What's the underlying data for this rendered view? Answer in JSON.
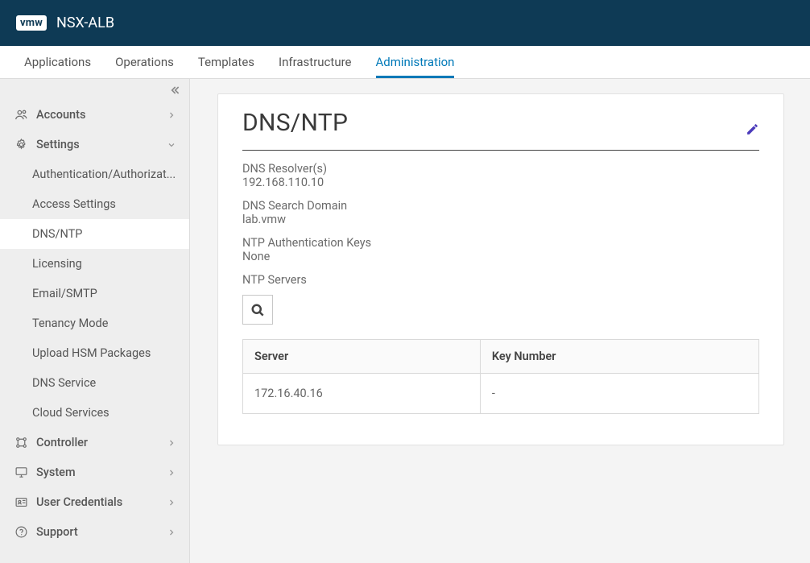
{
  "header": {
    "logo": "vmw",
    "product": "NSX-ALB"
  },
  "topnav": {
    "items": [
      "Applications",
      "Operations",
      "Templates",
      "Infrastructure",
      "Administration"
    ],
    "active_index": 4
  },
  "sidebar": {
    "groups": [
      {
        "label": "Accounts",
        "icon": "users",
        "expanded": false
      },
      {
        "label": "Settings",
        "icon": "gear",
        "expanded": true,
        "items": [
          "Authentication/Authorizat...",
          "Access Settings",
          "DNS/NTP",
          "Licensing",
          "Email/SMTP",
          "Tenancy Mode",
          "Upload HSM Packages",
          "DNS Service",
          "Cloud Services"
        ],
        "active_index": 2
      },
      {
        "label": "Controller",
        "icon": "nodes",
        "expanded": false
      },
      {
        "label": "System",
        "icon": "monitor",
        "expanded": false
      },
      {
        "label": "User Credentials",
        "icon": "idcard",
        "expanded": false
      },
      {
        "label": "Support",
        "icon": "help",
        "expanded": false
      }
    ]
  },
  "content": {
    "title": "DNS/NTP",
    "dns_resolvers_label": "DNS Resolver(s)",
    "dns_resolvers_value": "192.168.110.10",
    "dns_search_label": "DNS Search Domain",
    "dns_search_value": "lab.vmw",
    "ntp_auth_label": "NTP Authentication Keys",
    "ntp_auth_value": "None",
    "ntp_servers_label": "NTP Servers",
    "table": {
      "headers": [
        "Server",
        "Key Number"
      ],
      "rows": [
        {
          "server": "172.16.40.16",
          "key": "-"
        }
      ]
    }
  }
}
